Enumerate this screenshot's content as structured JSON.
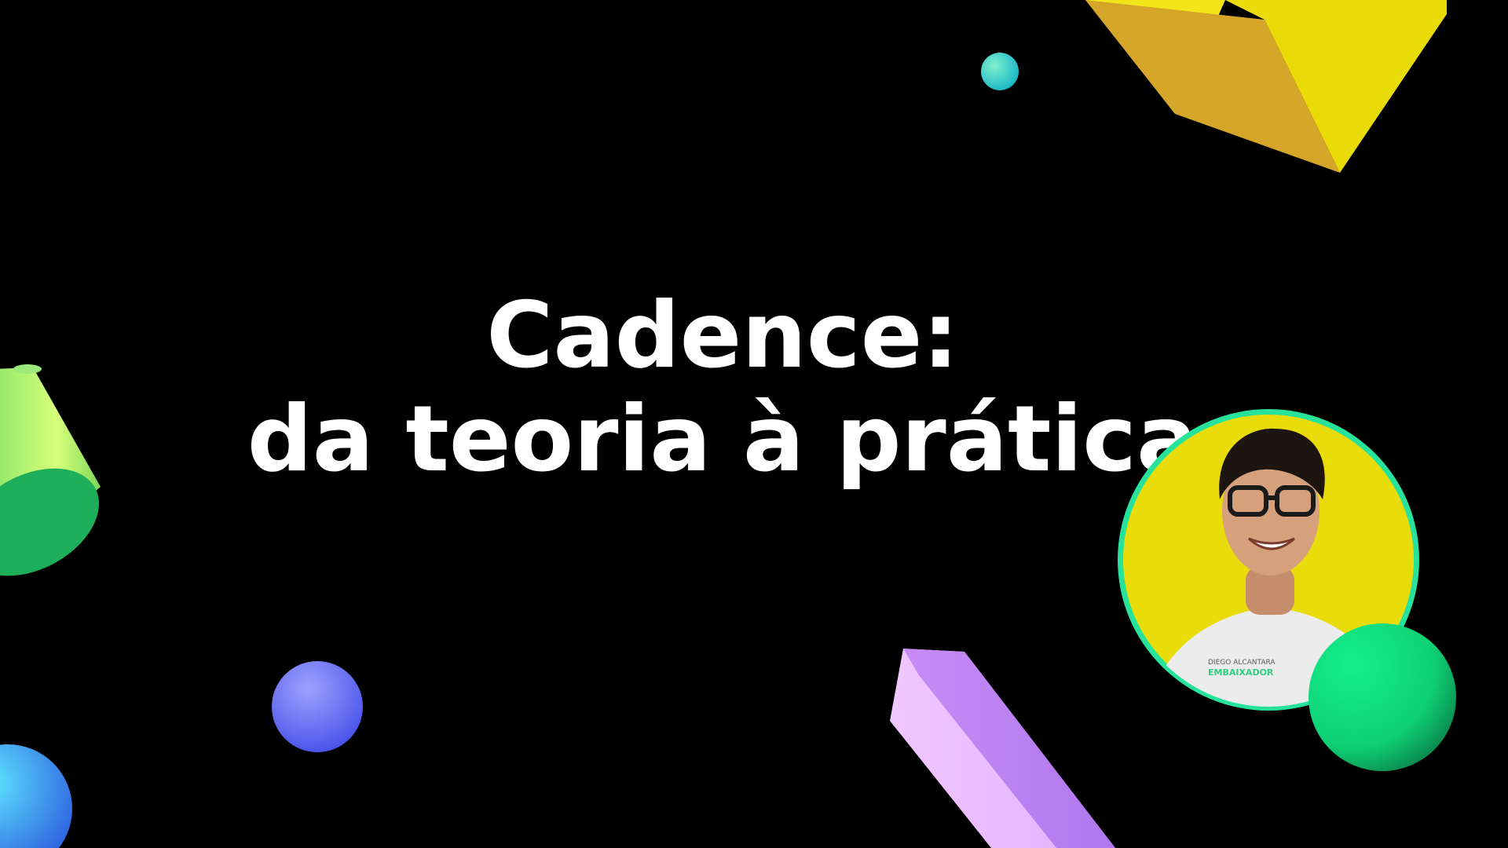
{
  "slide": {
    "title_line1": "Cadence:",
    "title_line2": "da teoria à prática"
  },
  "speaker": {
    "shirt_text_line1": "DIEGO ALCANTARA",
    "shirt_text_line2": "EMBAIXADOR"
  },
  "colors": {
    "background": "#000000",
    "title_text": "#ffffff",
    "avatar_background": "#e8dd0a",
    "avatar_ring": "#27e29a"
  },
  "decorations": [
    "yellow-cube-icon",
    "teal-sphere-icon",
    "green-cylinder-icon",
    "blue-sphere-icon",
    "cyan-sphere-icon",
    "purple-prism-icon",
    "green-sphere-icon"
  ]
}
